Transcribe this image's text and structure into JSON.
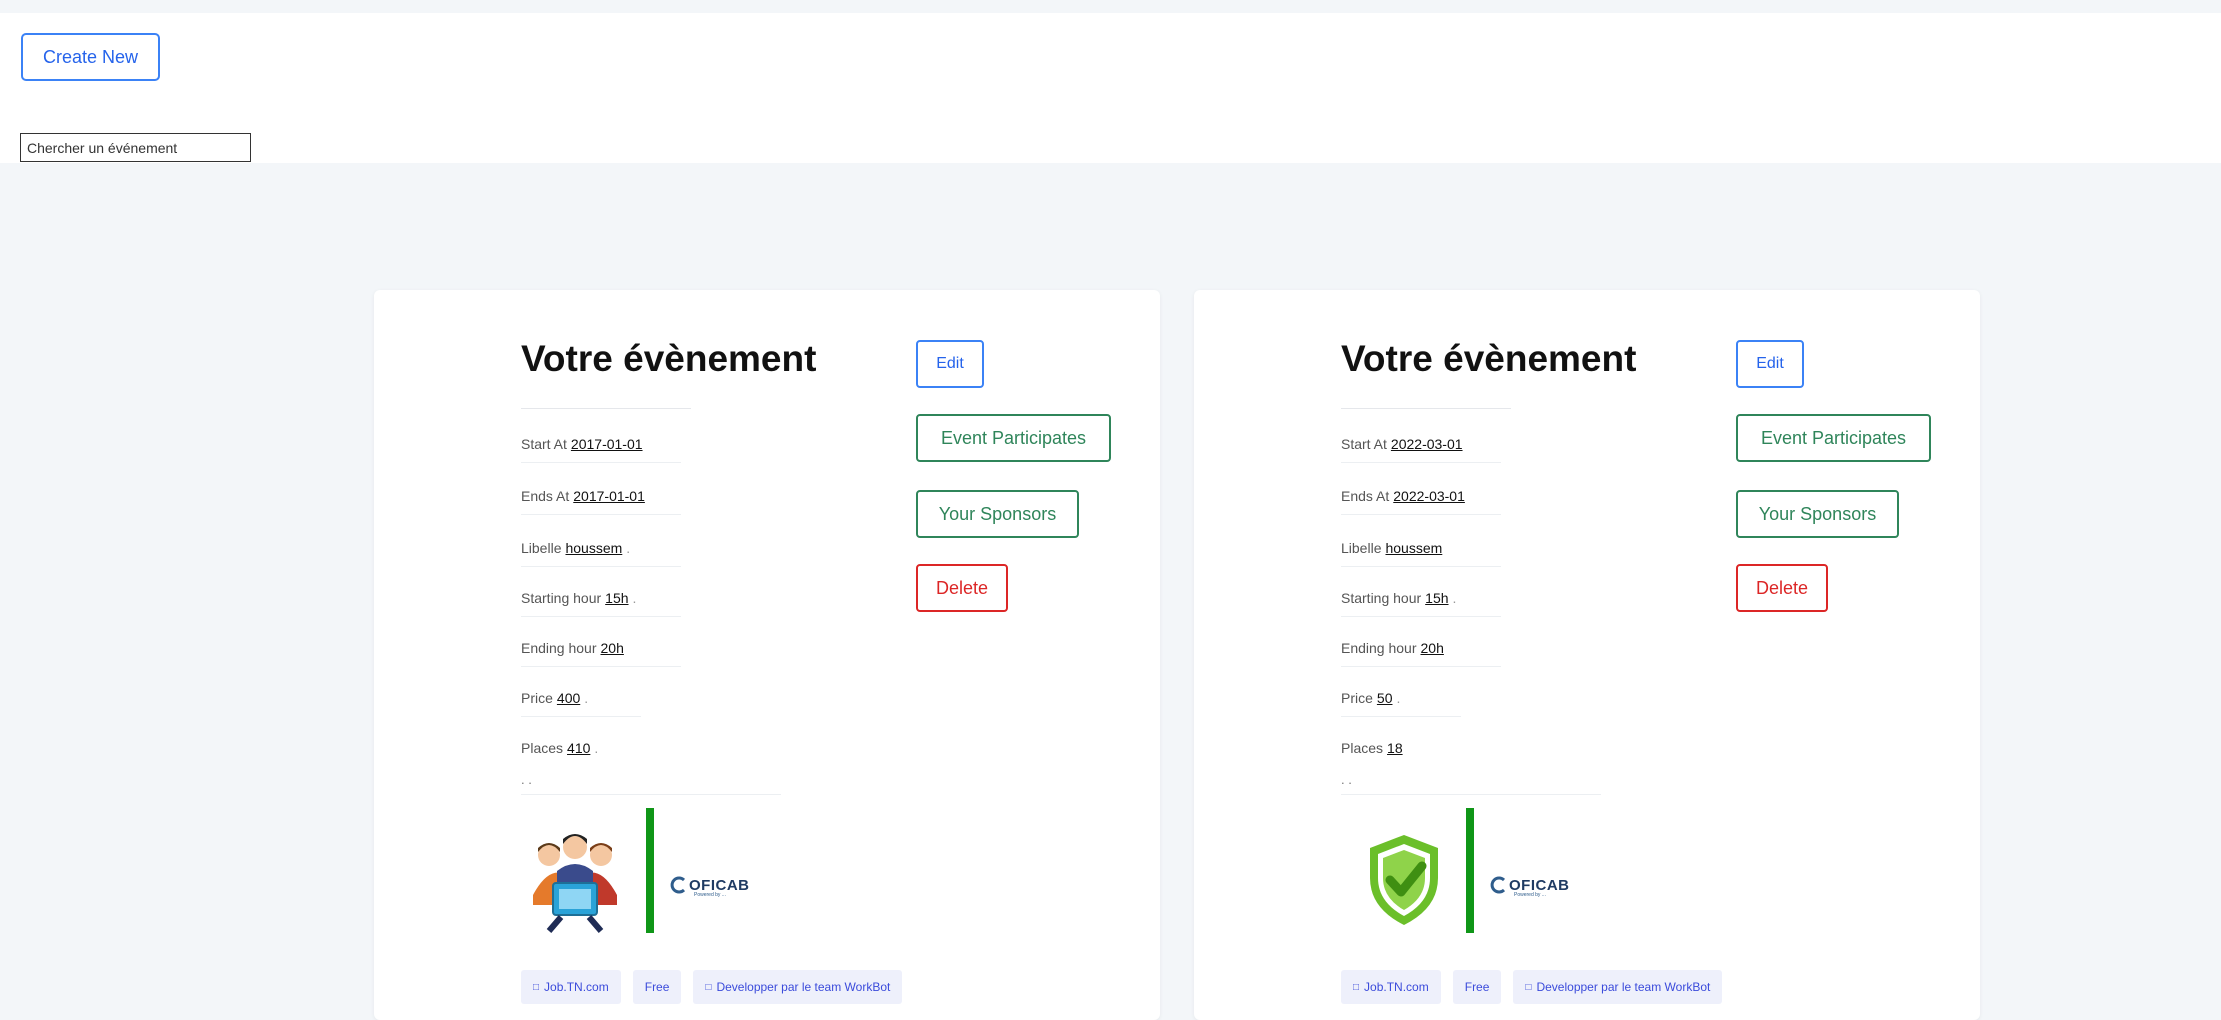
{
  "toolbar": {
    "create_label": "Create New",
    "search_placeholder": "Chercher un événement"
  },
  "events": [
    {
      "title": "Votre évènement",
      "fields": [
        {
          "label": "Start At",
          "value": "2017-01-01",
          "trail": ""
        },
        {
          "label": "Ends At",
          "value": "2017-01-01",
          "trail": ""
        },
        {
          "label": "Libelle",
          "value": "houssem",
          "trail": "."
        },
        {
          "label": "Starting hour",
          "value": "15h",
          "trail": "."
        },
        {
          "label": "Ending hour",
          "value": "20h",
          "trail": ""
        },
        {
          "label": "Price",
          "value": "400",
          "trail": "."
        },
        {
          "label": "Places",
          "value": "410",
          "trail": "."
        }
      ],
      "dots": ". .",
      "image_icon": "people-tablet-icon",
      "buttons": {
        "edit": "Edit",
        "participates": "Event Participates",
        "sponsors": "Your Sponsors",
        "delete": "Delete"
      },
      "logo": {
        "name": "OFICAB",
        "sub": "Powered by ..."
      },
      "tags": [
        {
          "icon": "□",
          "label": "Job.TN.com"
        },
        {
          "icon": "",
          "label": "Free"
        },
        {
          "icon": "□",
          "label": "Developper par le team WorkBot"
        }
      ]
    },
    {
      "title": "Votre évènement",
      "fields": [
        {
          "label": "Start At",
          "value": "2022-03-01",
          "trail": ""
        },
        {
          "label": "Ends At",
          "value": "2022-03-01",
          "trail": ""
        },
        {
          "label": "Libelle",
          "value": "houssem",
          "trail": ""
        },
        {
          "label": "Starting hour",
          "value": "15h",
          "trail": "."
        },
        {
          "label": "Ending hour",
          "value": "20h",
          "trail": ""
        },
        {
          "label": "Price",
          "value": "50",
          "trail": "."
        },
        {
          "label": "Places",
          "value": "18",
          "trail": ""
        }
      ],
      "dots": ". .",
      "image_icon": "shield-check-icon",
      "buttons": {
        "edit": "Edit",
        "participates": "Event Participates",
        "sponsors": "Your Sponsors",
        "delete": "Delete"
      },
      "logo": {
        "name": "OFICAB",
        "sub": "Powered by ..."
      },
      "tags": [
        {
          "icon": "□",
          "label": "Job.TN.com"
        },
        {
          "icon": "",
          "label": "Free"
        },
        {
          "icon": "□",
          "label": "Developper par le team WorkBot"
        }
      ]
    }
  ],
  "colors": {
    "primary": "#3b82f6",
    "success": "#2f855a",
    "danger": "#dc2626",
    "tag_bg": "#eef0fb",
    "logo_bar": "#109618"
  }
}
